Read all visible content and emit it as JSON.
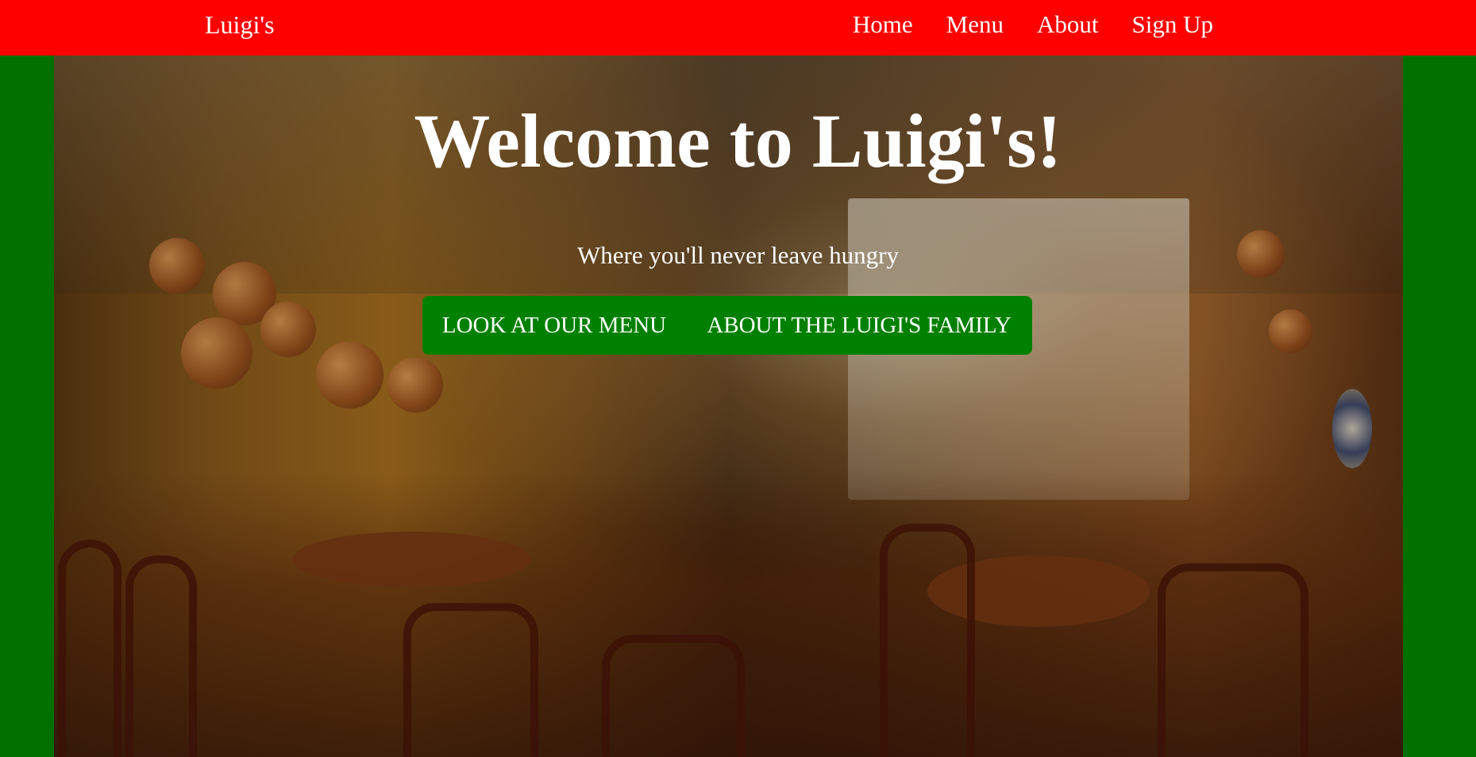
{
  "nav": {
    "brand": "Luigi's",
    "links": [
      "Home",
      "Menu",
      "About",
      "Sign Up"
    ]
  },
  "hero": {
    "title": "Welcome to Luigi's!",
    "subtitle": "Where you'll never leave hungry",
    "buttons": [
      "LOOK AT OUR MENU",
      "ABOUT THE LUIGI'S FAMILY"
    ]
  },
  "colors": {
    "nav_background": "#ff0000",
    "page_background": "#007000",
    "button_background": "#008000",
    "text": "#ffffff"
  }
}
